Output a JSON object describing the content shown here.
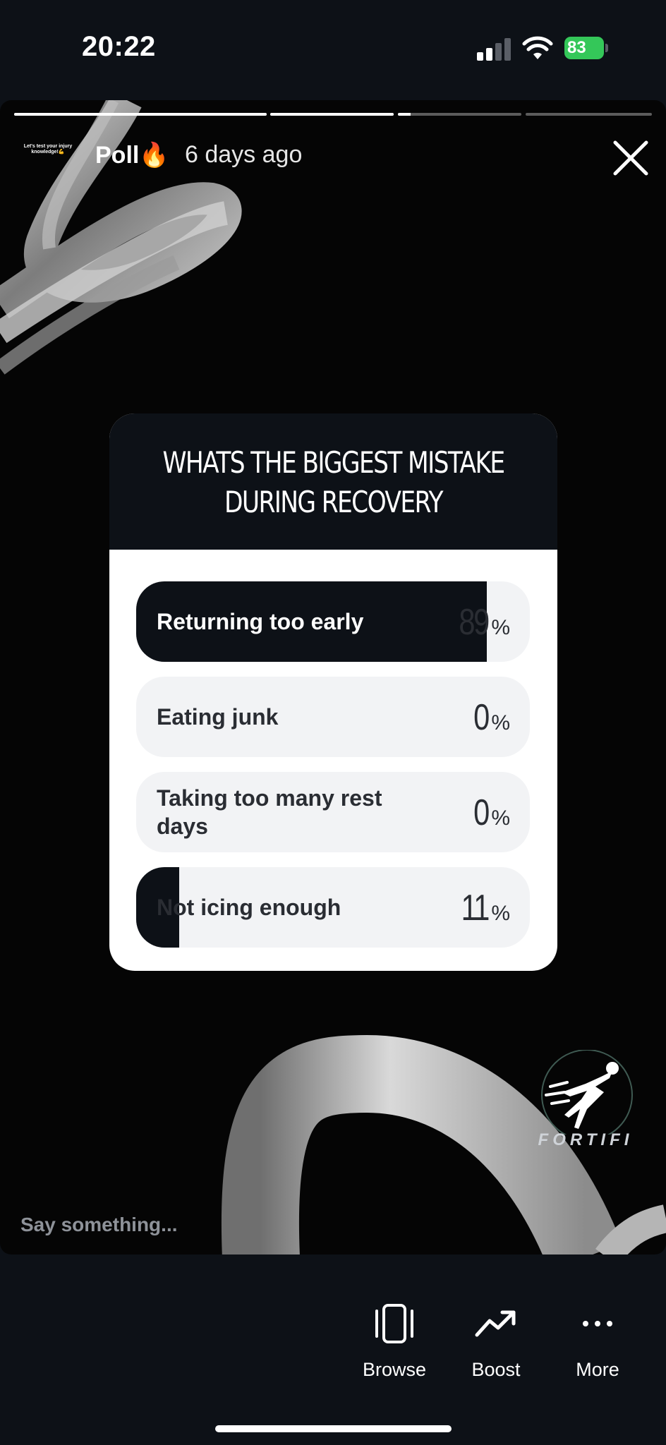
{
  "status_bar": {
    "time": "20:22",
    "battery": "83"
  },
  "story": {
    "progress": [
      1.0,
      1.0,
      0.1,
      0.0,
      0.0
    ],
    "avatar_text": "Let's test your injury knowledge!💪",
    "title": "Poll🔥",
    "posted": "6 days ago",
    "input_placeholder": "Say something..."
  },
  "poll": {
    "question": "WHATS THE BIGGEST MISTAKE DURING RECOVERY",
    "options": [
      {
        "label": "Returning too early",
        "percent": "89",
        "share": 0.89
      },
      {
        "label": "Eating junk",
        "percent": "0",
        "share": 0.0
      },
      {
        "label": "Taking too many rest days",
        "percent": "0",
        "share": 0.0
      },
      {
        "label": "Not icing enough",
        "percent": "11",
        "share": 0.11
      }
    ],
    "percent_sign": "%"
  },
  "brand": {
    "name": "FORTIFI"
  },
  "actions": [
    {
      "label": "Browse",
      "icon": "browse-icon"
    },
    {
      "label": "Boost",
      "icon": "trend-up-icon"
    },
    {
      "label": "More",
      "icon": "more-icon"
    }
  ],
  "colors": {
    "dark": "#0d1117",
    "option_bg": "#f2f3f5",
    "battery": "#34c759"
  }
}
